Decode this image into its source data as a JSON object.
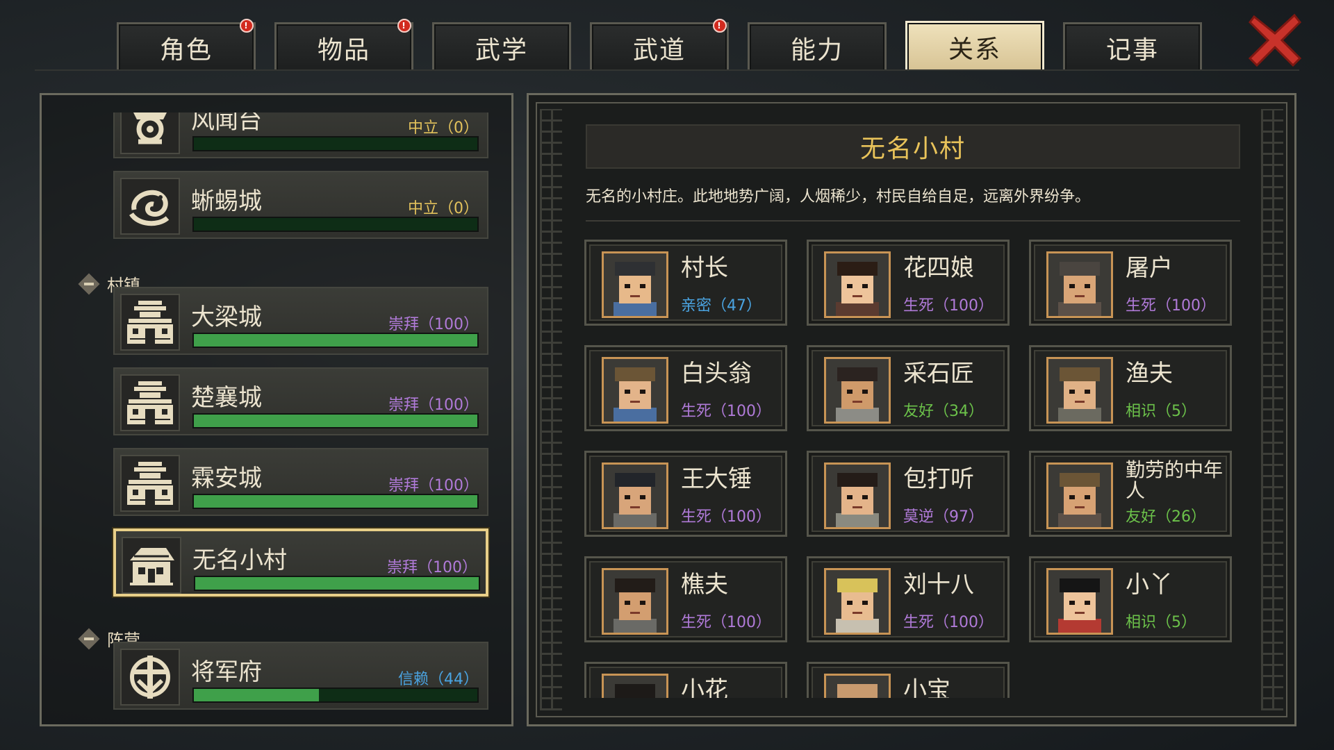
{
  "tabs": [
    {
      "label": "角色",
      "badge": "!",
      "active": false
    },
    {
      "label": "物品",
      "badge": "!",
      "active": false
    },
    {
      "label": "武学",
      "badge": "",
      "active": false
    },
    {
      "label": "武道",
      "badge": "!",
      "active": false
    },
    {
      "label": "能力",
      "badge": "",
      "active": false
    },
    {
      "label": "关系",
      "badge": "",
      "active": true
    },
    {
      "label": "记事",
      "badge": "",
      "active": false
    }
  ],
  "factions_top": [
    {
      "name": "风闻台",
      "status": "中立（0）",
      "status_color": "#e3c25c",
      "progress": 0,
      "icon": "sect-emblem-icon"
    },
    {
      "name": "蜥蜴城",
      "status": "中立（0）",
      "status_color": "#e3c25c",
      "progress": 0,
      "icon": "serpent-emblem-icon"
    }
  ],
  "groups": {
    "villages": "村镇",
    "camps": "阵营"
  },
  "factions_villages": [
    {
      "name": "大梁城",
      "status": "崇拜（100）",
      "status_color": "#b07ad8",
      "progress": 100,
      "icon": "city-gate-icon"
    },
    {
      "name": "楚襄城",
      "status": "崇拜（100）",
      "status_color": "#b07ad8",
      "progress": 100,
      "icon": "city-gate-icon"
    },
    {
      "name": "霖安城",
      "status": "崇拜（100）",
      "status_color": "#b07ad8",
      "progress": 100,
      "icon": "city-gate-icon"
    },
    {
      "name": "无名小村",
      "status": "崇拜（100）",
      "status_color": "#b07ad8",
      "progress": 100,
      "icon": "village-hut-icon",
      "selected": true
    }
  ],
  "factions_camps": [
    {
      "name": "将军府",
      "status": "信赖（44）",
      "status_color": "#4aa3e0",
      "progress": 44,
      "icon": "general-emblem-icon"
    }
  ],
  "detail": {
    "title": "无名小村",
    "description": "无名的小村庄。此地地势广阔，人烟稀少，村民自给自足，远离外界纷争。"
  },
  "npcs": [
    {
      "name": "村长",
      "status": "亲密（47）",
      "status_color": "#4aa3e0",
      "icon": "elder-portrait-icon"
    },
    {
      "name": "花四娘",
      "status": "生死（100）",
      "status_color": "#b07ad8",
      "icon": "woman-portrait-icon"
    },
    {
      "name": "屠户",
      "status": "生死（100）",
      "status_color": "#b07ad8",
      "icon": "butcher-portrait-icon"
    },
    {
      "name": "白头翁",
      "status": "生死（100）",
      "status_color": "#b07ad8",
      "icon": "old-man-portrait-icon"
    },
    {
      "name": "采石匠",
      "status": "友好（34）",
      "status_color": "#6cc24a",
      "icon": "stonemason-portrait-icon"
    },
    {
      "name": "渔夫",
      "status": "相识（5）",
      "status_color": "#6cc24a",
      "icon": "fisherman-portrait-icon"
    },
    {
      "name": "王大锤",
      "status": "生死（100）",
      "status_color": "#b07ad8",
      "icon": "smith-portrait-icon"
    },
    {
      "name": "包打听",
      "status": "莫逆（97）",
      "status_color": "#b07ad8",
      "icon": "gossip-portrait-icon"
    },
    {
      "name": "勤劳的中年人",
      "status": "友好（26）",
      "status_color": "#6cc24a",
      "icon": "farmer-portrait-icon"
    },
    {
      "name": "樵夫",
      "status": "生死（100）",
      "status_color": "#b07ad8",
      "icon": "woodcutter-portrait-icon"
    },
    {
      "name": "刘十八",
      "status": "生死（100）",
      "status_color": "#b07ad8",
      "icon": "tiger-hat-portrait-icon"
    },
    {
      "name": "小丫",
      "status": "相识（5）",
      "status_color": "#6cc24a",
      "icon": "girl-portrait-icon"
    },
    {
      "name": "小花",
      "status": "",
      "status_color": "#b07ad8",
      "icon": "child-portrait-icon"
    },
    {
      "name": "小宝",
      "status": "",
      "status_color": "#b07ad8",
      "icon": "baby-portrait-icon"
    }
  ],
  "colors": {
    "accent_gold": "#e9c35a",
    "progress_green": "#3fa04a",
    "close_red": "#c8322a",
    "badge_red": "#d22a1e"
  }
}
